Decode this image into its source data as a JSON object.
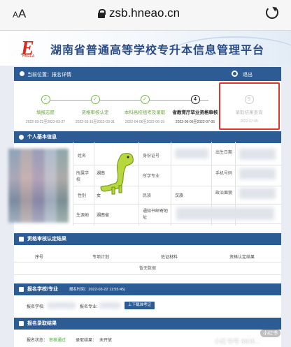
{
  "browser": {
    "aa_small": "A",
    "aa_large": "A",
    "url": "zsb.hneao.cn"
  },
  "banner": {
    "logo_letter": "E",
    "logo_tag": "HNEEA",
    "title": "湖南省普通高等学校专升本信息管理平台"
  },
  "navbar": {
    "crumb": "当前位置：报名详情",
    "logout": "退出"
  },
  "steps": [
    {
      "num": "✓",
      "label": "填报志愿",
      "date": "2022-03-22至2022-03-27",
      "state": "done"
    },
    {
      "num": "✓",
      "label": "资格审核认定",
      "date": "2022-03-16至2022-03-31",
      "state": "done"
    },
    {
      "num": "✓",
      "label": "本科高校组考及录取",
      "date": "2022-04-06至2022-06-19",
      "state": "done"
    },
    {
      "num": "4",
      "label": "省教育厅毕业资格审核",
      "date": "2022-06-06至2022-07-05",
      "state": "active"
    },
    {
      "num": "5",
      "label": "录取结果查询",
      "date": "2022-07-05",
      "state": "inactive"
    }
  ],
  "personal": {
    "header": "个人基本信息",
    "name_label": "姓名",
    "id_label": "身份证号",
    "birth_label": "出生日期",
    "school_label": "所属学校",
    "school_value": "湖南",
    "major_label": "所学专业",
    "phone_label": "手机号码",
    "gender_label": "性别",
    "gender_value": "女",
    "ethnic_label": "民族",
    "ethnic_value": "汉族",
    "politics_label": "政治面貌",
    "origin_label": "生源地",
    "origin_value": "湖南省",
    "address_label": "通知书邮寄地址"
  },
  "verification": {
    "header": "资格审核认定结果",
    "columns": [
      "序号",
      "专项计划",
      "佐证材料",
      "资格认定结果"
    ],
    "empty": "暂无数据"
  },
  "school_major": {
    "header": "报名学校/专业",
    "time": "报名时间：2022-03-22 11:55:45)",
    "school_label": "报名学校:",
    "major_label": "报名专业:",
    "button": "上下载准考证"
  },
  "admission": {
    "header": "报名录取结果",
    "status_label": "报名状态：",
    "status_value": "审核通过",
    "result_label": "录取结果：",
    "result_value": "未开放"
  },
  "watermark": {
    "text": "小红书号 5805...",
    "badge": "小红书"
  }
}
